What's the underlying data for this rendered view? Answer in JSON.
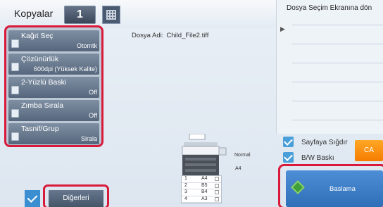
{
  "header": {
    "copies_label": "Kopyalar",
    "copies_count": "1",
    "keypad_icon": "keypad-grid-icon"
  },
  "functions": [
    {
      "title": "Kağıt Seç",
      "value": "Otomtk",
      "icon": "paper-icon"
    },
    {
      "title": "Çözünürlük",
      "value": "600dpi (Yüksek Kalite)",
      "icon": "resolution-icon"
    },
    {
      "title": "2-Yüzlü Baski",
      "value": "Off",
      "icon": "duplex-icon"
    },
    {
      "title": "Zımba Sırala",
      "value": "Off",
      "icon": "staple-icon"
    },
    {
      "title": "Tasnif/Grup",
      "value": "Sirala",
      "icon": "sort-icon"
    }
  ],
  "file": {
    "label": "Dosya Adi:",
    "name": "Child_File2.tiff"
  },
  "right_panel": {
    "title": "Dosya Seçim Ekranına dön"
  },
  "options": {
    "fit_label": "Sayfaya Sığdır",
    "fit_checked": true,
    "bw_label": "B/W Baskı",
    "bw_checked": true
  },
  "buttons": {
    "ca": "CA",
    "start": "Baslama",
    "others": "Diğerleri"
  },
  "paper": {
    "normal": "Normal",
    "a4": "A4"
  },
  "trays": [
    {
      "num": "1",
      "size": "A4"
    },
    {
      "num": "2",
      "size": "B5"
    },
    {
      "num": "3",
      "size": "B4"
    },
    {
      "num": "4",
      "size": "A3"
    }
  ],
  "colors": {
    "accent_red": "#d91a3a",
    "start_blue": "#2e6fb8",
    "ca_orange": "#f57c00",
    "check_blue": "#4a9fd9"
  }
}
